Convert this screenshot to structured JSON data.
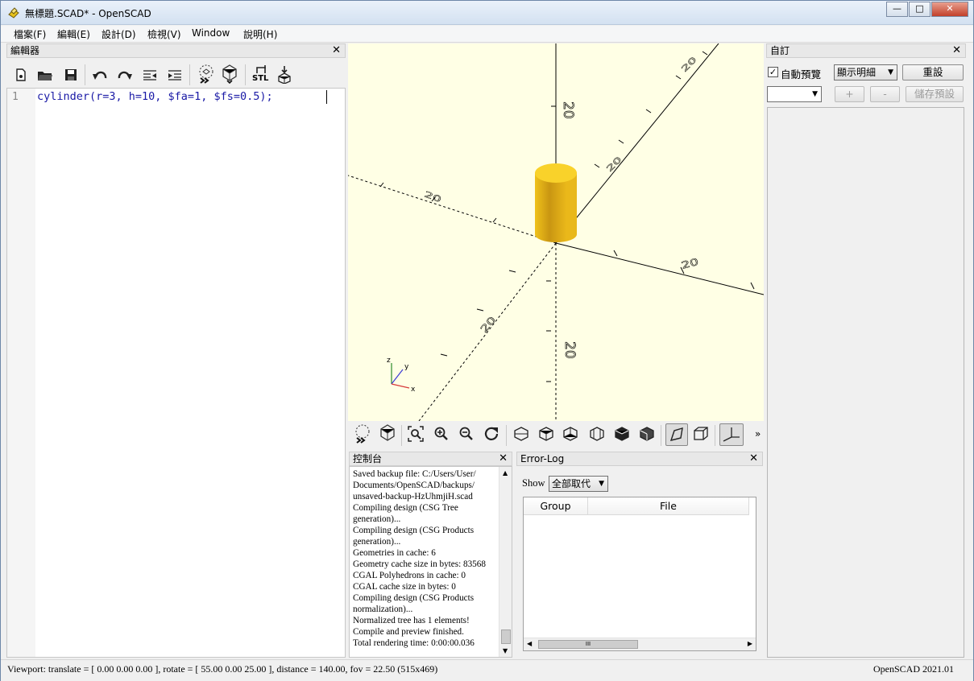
{
  "window": {
    "title": "無標題.SCAD* - OpenSCAD",
    "minimize": "—",
    "maximize": "□",
    "close": "✕"
  },
  "menu": [
    "檔案(F)",
    "編輯(E)",
    "設計(D)",
    "檢視(V)",
    "Window",
    "說明(H)"
  ],
  "editor": {
    "title": "編輯器",
    "line_number": "1",
    "code": "cylinder(r=3, h=10, $fa=1, $fs=0.5);",
    "stl_label": "STL"
  },
  "viewport": {
    "axis_labels": [
      "20",
      "20",
      "20",
      "20",
      "20",
      "20",
      "20"
    ],
    "axis_letters": [
      "z",
      "y",
      "x"
    ]
  },
  "console": {
    "title": "控制台",
    "lines": [
      "Saved backup file: C:/Users/User/",
      "Documents/OpenSCAD/backups/",
      "unsaved-backup-HzUhmjiH.scad",
      "Compiling design (CSG Tree",
      "generation)...",
      "Compiling design (CSG Products",
      "generation)...",
      "Geometries in cache: 6",
      "Geometry cache size in bytes: 83568",
      "CGAL Polyhedrons in cache: 0",
      "CGAL cache size in bytes: 0",
      "Compiling design (CSG Products",
      "normalization)...",
      "Normalized tree has 1 elements!",
      "Compile and preview finished.",
      "Total rendering time: 0:00:00.036"
    ]
  },
  "error_log": {
    "title": "Error-Log",
    "show_label": "Show",
    "filter": "全部取代",
    "columns": [
      "Group",
      "File"
    ],
    "hscroll_grip": "III"
  },
  "customizer": {
    "title": "自訂",
    "auto_preview_label": "自動預覽",
    "auto_preview_checked": true,
    "detail_select": "顯示明細",
    "reset": "重設",
    "preset_select": "",
    "add": "+",
    "remove": "-",
    "save_preset": "儲存預設"
  },
  "status": {
    "viewport": "Viewport: translate = [ 0.00 0.00 0.00 ], rotate = [ 55.00 0.00 25.00 ], distance = 140.00, fov = 22.50 (515x469)",
    "version": "OpenSCAD 2021.01"
  },
  "colors": {
    "viewport_bg": "#ffffe5",
    "model_yellow": "#f5cf1e",
    "code_blue": "#1a1aa6"
  }
}
